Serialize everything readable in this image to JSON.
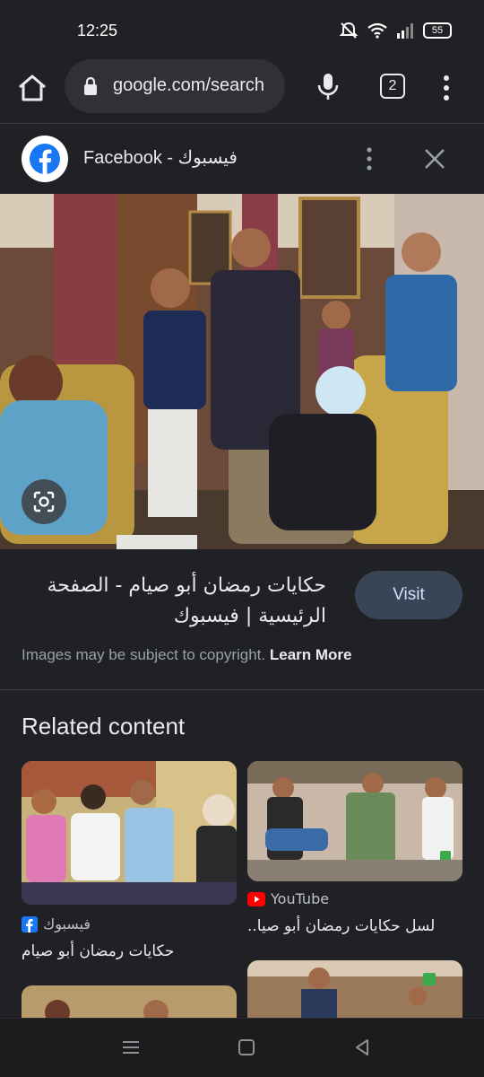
{
  "status_bar": {
    "time": "12:25",
    "battery": "55"
  },
  "browser": {
    "url": "google.com/search",
    "tab_count": "2"
  },
  "source_header": {
    "title": "Facebook - فيسبوك"
  },
  "result": {
    "title": "حكايات رمضان أبو صيام - الصفحة الرئيسية | فيسبوك",
    "visit_label": "Visit",
    "copyright_text": "Images may be subject to copyright.",
    "learn_more_label": "Learn More"
  },
  "related": {
    "heading": "Related content",
    "items": [
      {
        "source": "فيسبوك",
        "title": "حكايات رمضان أبو صيام"
      },
      {
        "source": "YouTube",
        "title": "لسل حكايات رمضان أبو صيا.."
      },
      {
        "source": "",
        "title": ""
      },
      {
        "source": "",
        "title": ""
      }
    ]
  },
  "colors": {
    "background": "#202124",
    "visit_button": "#394457",
    "facebook_blue": "#1877f2",
    "youtube_red": "#ff0000"
  }
}
